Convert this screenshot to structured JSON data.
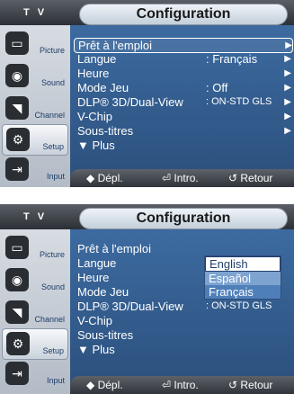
{
  "tv_label": "T V",
  "title": "Configuration",
  "sidebar": [
    {
      "label": "Picture",
      "icon": "picture-icon"
    },
    {
      "label": "Sound",
      "icon": "sound-icon"
    },
    {
      "label": "Channel",
      "icon": "channel-icon"
    },
    {
      "label": "Setup",
      "icon": "setup-icon"
    },
    {
      "label": "Input",
      "icon": "input-icon"
    }
  ],
  "menu": {
    "items": [
      {
        "label": "Prêt à l'emploi",
        "value": "",
        "arrow": "▶"
      },
      {
        "label": "Langue",
        "value": ": Français",
        "arrow": "▶"
      },
      {
        "label": "Heure",
        "value": "",
        "arrow": "▶"
      },
      {
        "label": "Mode Jeu",
        "value": ": Off",
        "arrow": "▶"
      },
      {
        "label": "DLP® 3D/Dual-View",
        "value": ": ON-STD GLS",
        "arrow": "▶"
      },
      {
        "label": "V-Chip",
        "value": "",
        "arrow": "▶"
      },
      {
        "label": "Sous-titres",
        "value": "",
        "arrow": "▶"
      },
      {
        "label": "▼ Plus",
        "value": "",
        "arrow": ""
      }
    ]
  },
  "menu2": {
    "items": [
      {
        "label": "Prêt à l'emploi"
      },
      {
        "label": "Langue"
      },
      {
        "label": "Heure"
      },
      {
        "label": "Mode Jeu"
      },
      {
        "label": "DLP® 3D/Dual-View"
      },
      {
        "label": "V-Chip"
      },
      {
        "label": "Sous-titres"
      },
      {
        "label": "▼ Plus"
      }
    ],
    "dlp_value": ": ON-STD GLS",
    "dropdown": [
      "English",
      "Español",
      "Français"
    ]
  },
  "hints": {
    "move": "◆ Dépl.",
    "enter": "⏎ Intro.",
    "back": "↺ Retour"
  },
  "colors": {
    "background": "#2b4f7c",
    "accent": "#ffffff"
  }
}
